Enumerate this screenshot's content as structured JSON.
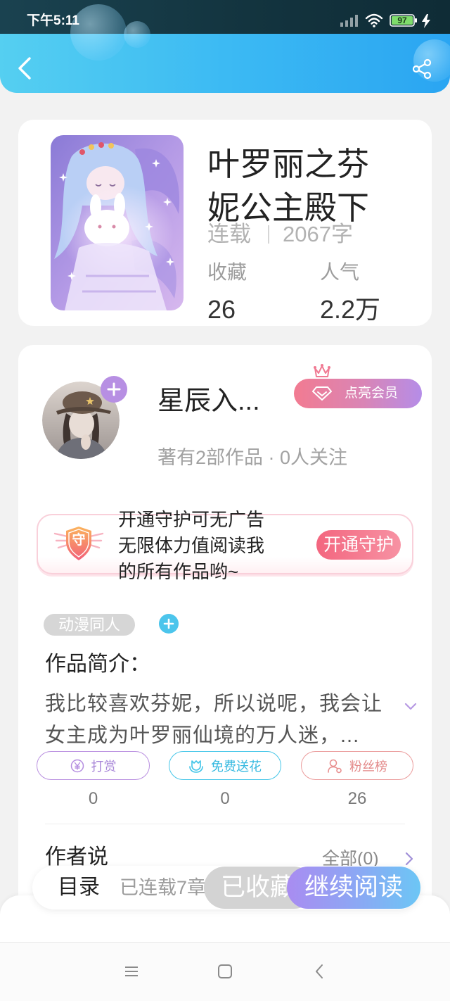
{
  "status_bar": {
    "time": "下午5:11",
    "battery_level": "97",
    "icons": [
      "signal-icon",
      "wifi-icon",
      "battery-icon",
      "charging-icon"
    ]
  },
  "header": {
    "icons": [
      "back-chevron-icon",
      "share-icon"
    ]
  },
  "book": {
    "title_lines": [
      "叶罗丽之芬",
      "妮公主殿下"
    ],
    "status": "连载",
    "word_count": "2067字",
    "stats": [
      {
        "label": "收藏",
        "value": "26"
      },
      {
        "label": "人气",
        "value": "2.2万"
      }
    ]
  },
  "author": {
    "name": "星辰入...",
    "summary": "著有2部作品 · 0人关注",
    "member_button": "点亮会员"
  },
  "guard_banner": {
    "badge_char": "守",
    "lines": [
      "开通守护可无广告",
      "无限体力值阅读我",
      "的所有作品哟~"
    ],
    "button": "开通守护"
  },
  "tags": [
    "动漫同人"
  ],
  "intro": {
    "heading": "作品简介：",
    "lines": [
      "我比较喜欢芬妮，所以说呢，我会让",
      "女主成为叶罗丽仙境的万人迷，..."
    ]
  },
  "actions": [
    {
      "label": "打赏",
      "count": "0",
      "icon": "yen-coin-icon",
      "color": "#b48de0"
    },
    {
      "label": "免费送花",
      "count": "0",
      "icon": "flower-icon",
      "color": "#3fc4e8"
    },
    {
      "label": "粉丝榜",
      "count": "26",
      "icon": "user-icon",
      "color": "#e88f8f"
    }
  ],
  "author_notes": {
    "heading": "作者说",
    "all_link": "全部(0)"
  },
  "bottom_bar": {
    "catalog": "目录",
    "chapters": "已连载7章",
    "favorited": "已收藏",
    "continue_reading": "继续阅读"
  },
  "colors": {
    "status_bar": "#143642",
    "header_gradient": [
      "#55cff1",
      "#2aa5f2"
    ],
    "page_background": "#f2f2f2",
    "member_gradient": [
      "#f27b91",
      "#b58de8"
    ],
    "guard_button": [
      "#f3667f",
      "#f792a3"
    ],
    "continue_gradient": [
      "#a98cf1",
      "#6cc6f5"
    ],
    "favorited_button": "#d3d3d3"
  }
}
